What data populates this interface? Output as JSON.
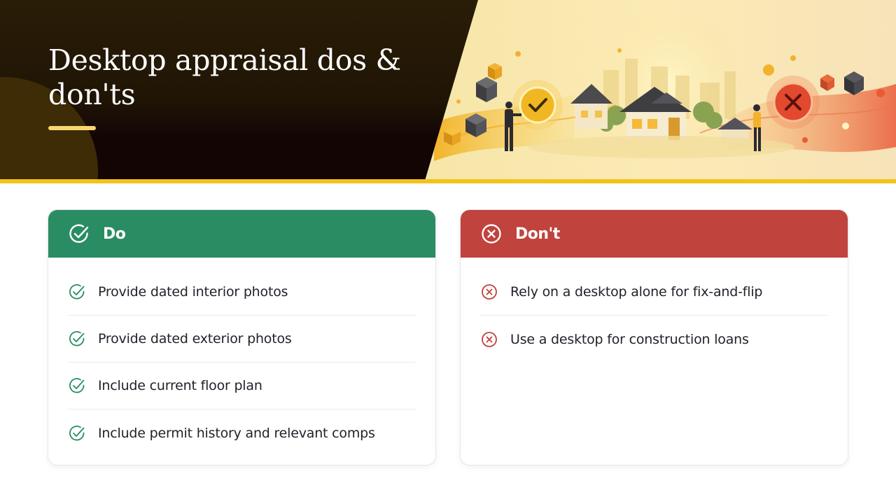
{
  "header": {
    "title": "Desktop appraisal dos & don'ts"
  },
  "do_card": {
    "label": "Do",
    "icon": "check-circle-icon",
    "color": "#2a8c62",
    "items": [
      "Provide dated interior photos",
      "Provide dated exterior photos",
      "Include current floor plan",
      "Include permit history and relevant comps"
    ]
  },
  "dont_card": {
    "label": "Don't",
    "icon": "x-circle-icon",
    "color": "#c0433d",
    "items": [
      "Rely on a desktop alone for fix-and-flip",
      "Use a desktop for construction loans"
    ]
  },
  "colors": {
    "header_dark": "#1b1309",
    "accent": "#f4c21b"
  }
}
